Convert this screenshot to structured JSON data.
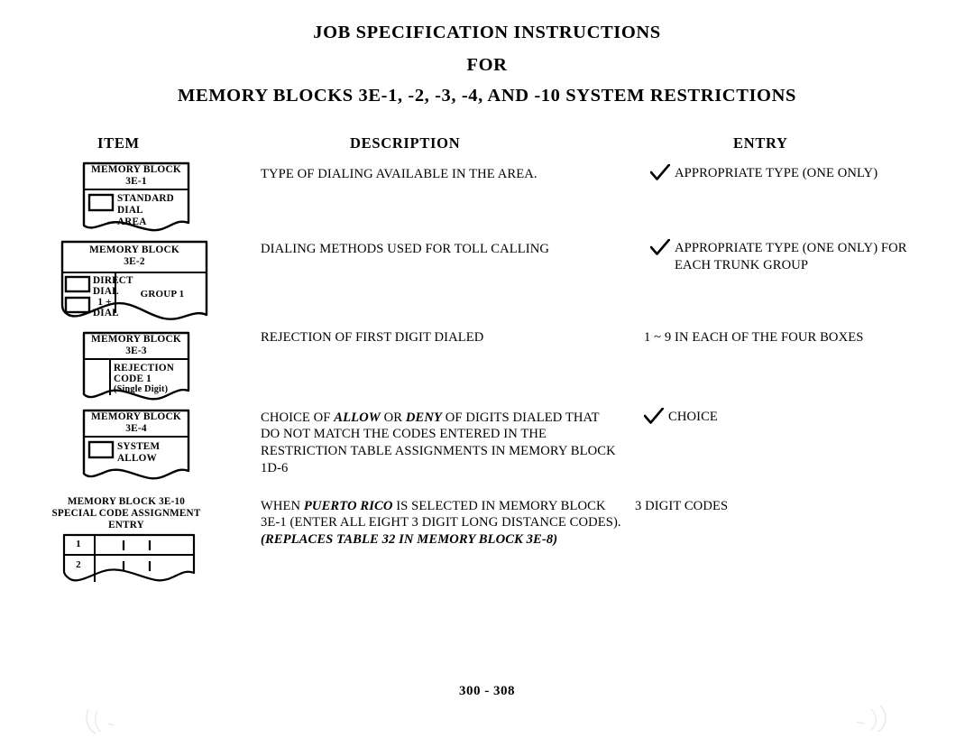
{
  "document": {
    "title_lines": [
      "JOB  SPECIFICATION  INSTRUCTIONS",
      "FOR",
      "MEMORY BLOCKS 3E-1, -2, -3, -4, AND -10  SYSTEM  RESTRICTIONS"
    ],
    "footer": "300 - 308"
  },
  "columns": {
    "item": "ITEM",
    "description": "DESCRIPTION",
    "entry": "ENTRY"
  },
  "rows": [
    {
      "id": "row-3e-1",
      "item": {
        "block_title": "MEMORY BLOCK",
        "block_number": "3E-1",
        "fields": [
          {
            "label_lines": [
              "STANDARD",
              "DIAL",
              "AREA"
            ],
            "has_checkbox": true
          }
        ]
      },
      "description": "TYPE OF DIALING AVAILABLE IN THE AREA.",
      "entry": {
        "checked": true,
        "text": "APPROPRIATE  TYPE  (ONE ONLY)"
      }
    },
    {
      "id": "row-3e-2",
      "item": {
        "block_title": "MEMORY BLOCK",
        "block_number": "3E-2",
        "fields": [
          {
            "label_lines": [
              "DIRECT",
              "DIAL"
            ],
            "has_checkbox": true
          },
          {
            "label_lines": [
              "1 +",
              "DIAL"
            ],
            "has_checkbox": true
          }
        ],
        "group_label": "GROUP 1"
      },
      "description": "DIALING METHODS USED FOR TOLL CALLING",
      "entry": {
        "checked": true,
        "text": "APPROPRIATE  TYPE  (ONE ONLY) FOR EACH TRUNK GROUP"
      }
    },
    {
      "id": "row-3e-3",
      "item": {
        "block_title": "MEMORY BLOCK",
        "block_number": "3E-3",
        "fields": [
          {
            "label_lines": [
              "REJECTION",
              "CODE  1",
              "(Single Digit)"
            ],
            "has_checkbox": false
          }
        ]
      },
      "description": "REJECTION OF  FIRST DIGIT DIALED",
      "entry": {
        "checked": false,
        "text": "1 ~ 9 IN EACH  OF THE  FOUR BOXES"
      }
    },
    {
      "id": "row-3e-4",
      "item": {
        "block_title": "MEMORY BLOCK",
        "block_number": "3E-4",
        "fields": [
          {
            "label_lines": [
              "SYSTEM",
              "ALLOW"
            ],
            "has_checkbox": true
          }
        ]
      },
      "description_html": "CHOICE OF <i>ALLOW</i> OR <i>DENY</i> OF DIGITS DIALED THAT DO NOT MATCH THE CODES ENTERED IN THE RESTRICTION  TABLE ASSIGNMENTS IN MEMORY BLOCK 1D-6",
      "entry": {
        "checked": true,
        "text": "CHOICE"
      }
    },
    {
      "id": "row-3e-10",
      "item": {
        "caption_lines": [
          "MEMORY BLOCK  3E-10",
          "SPECIAL CODE ASSIGNMENT",
          "ENTRY"
        ],
        "table_rows": [
          "1",
          "2"
        ]
      },
      "description_html": "WHEN  <i>PUERTO RICO</i> IS SELECTED IN MEMORY BLOCK 3E-1  (ENTER ALL EIGHT 3 DIGIT LONG DISTANCE  CODES).  <i>(REPLACES TABLE 32 IN MEMORY BLOCK 3E-8)</i>",
      "entry": {
        "checked": false,
        "text": "3 DIGIT CODES"
      }
    }
  ],
  "colors": {
    "ink": "#000000",
    "paper": "#ffffff"
  }
}
